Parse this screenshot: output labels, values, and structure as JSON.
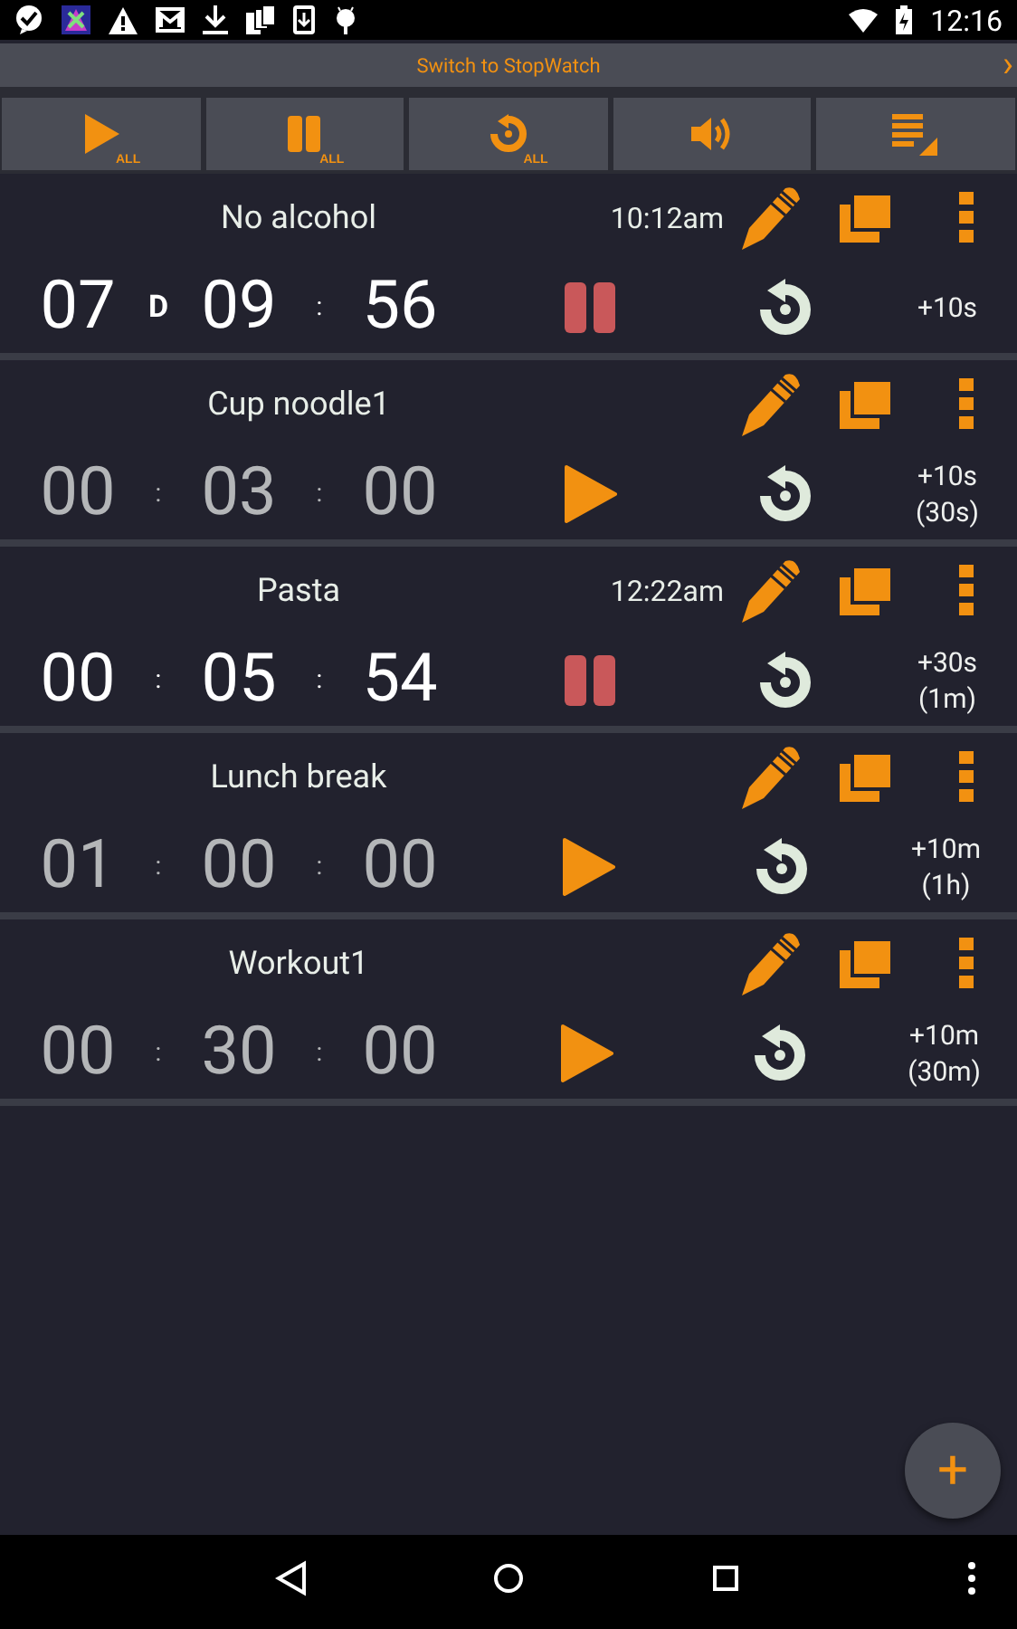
{
  "status_bar": {
    "time": "12:16"
  },
  "switch_bar": {
    "label": "Switch to StopWatch",
    "arrow": "›"
  },
  "toolbar": [
    {
      "kind": "play",
      "badge": "ALL"
    },
    {
      "kind": "pause",
      "badge": "ALL"
    },
    {
      "kind": "reset",
      "badge": "ALL"
    },
    {
      "kind": "sound"
    },
    {
      "kind": "list"
    }
  ],
  "timers": [
    {
      "title": "No alcohol",
      "alarm_time": "10:12am",
      "fields": [
        "07",
        "09",
        "56"
      ],
      "separators": [
        "D",
        ":"
      ],
      "running": true,
      "increment": "+10s"
    },
    {
      "title": "Cup noodle1",
      "fields": [
        "00",
        "03",
        "00"
      ],
      "separators": [
        ":",
        ":"
      ],
      "running": false,
      "increment": "+10s",
      "increment_note": "(30s)"
    },
    {
      "title": "Pasta",
      "alarm_time": "12:22am",
      "fields": [
        "00",
        "05",
        "54"
      ],
      "separators": [
        ":",
        ":"
      ],
      "running": true,
      "increment": "+30s",
      "increment_note": "(1m)"
    },
    {
      "title": "Lunch break",
      "fields": [
        "01",
        "00",
        "00"
      ],
      "separators": [
        ":",
        ":"
      ],
      "running": false,
      "increment": "+10m",
      "increment_note": "(1h)"
    },
    {
      "title": "Workout1",
      "fields": [
        "00",
        "30",
        "00"
      ],
      "separators": [
        ":",
        ":"
      ],
      "running": false,
      "increment": "+10m",
      "increment_note": "(30m)"
    }
  ],
  "fab": {
    "label": "+"
  }
}
